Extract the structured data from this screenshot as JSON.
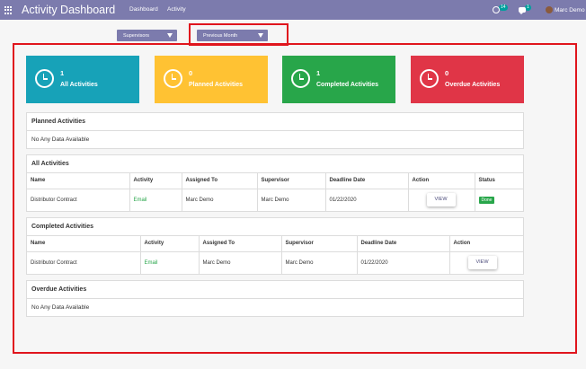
{
  "topbar": {
    "title": "Activity Dashboard",
    "menu": [
      "Dashboard",
      "Activity"
    ],
    "activity_count": "14",
    "message_count": "1",
    "user_name": "Marc Demo",
    "bg_color": "#7c7bad"
  },
  "filters": {
    "supervisor_label": "Supervisors",
    "period_label": "Previous Month"
  },
  "cards": [
    {
      "count": "1",
      "label": "All Activities",
      "color": "#17a2b8"
    },
    {
      "count": "0",
      "label": "Planned Activities",
      "color": "#ffc233"
    },
    {
      "count": "1",
      "label": "Completed Activities",
      "color": "#28a64a"
    },
    {
      "count": "0",
      "label": "Overdue Activities",
      "color": "#e03547"
    }
  ],
  "planned": {
    "title": "Planned Activities",
    "empty": "No Any Data Available"
  },
  "all": {
    "title": "All Activities",
    "columns": [
      "Name",
      "Activity",
      "Assigned To",
      "Supervisor",
      "Deadline Date",
      "Action",
      "Status"
    ],
    "rows": [
      {
        "name": "Distributor Contract",
        "activity": "Email",
        "assigned_to": "Marc Demo",
        "supervisor": "Marc Demo",
        "deadline": "01/22/2020",
        "action": "VIEW",
        "status": "Done"
      }
    ]
  },
  "completed": {
    "title": "Completed Activities",
    "columns": [
      "Name",
      "Activity",
      "Assigned To",
      "Supervisor",
      "Deadline Date",
      "Action"
    ],
    "rows": [
      {
        "name": "Distributor Contract",
        "activity": "Email",
        "assigned_to": "Marc Demo",
        "supervisor": "Marc Demo",
        "deadline": "01/22/2020",
        "action": "VIEW"
      }
    ]
  },
  "overdue": {
    "title": "Overdue Activities",
    "empty": "No Any Data Available"
  }
}
